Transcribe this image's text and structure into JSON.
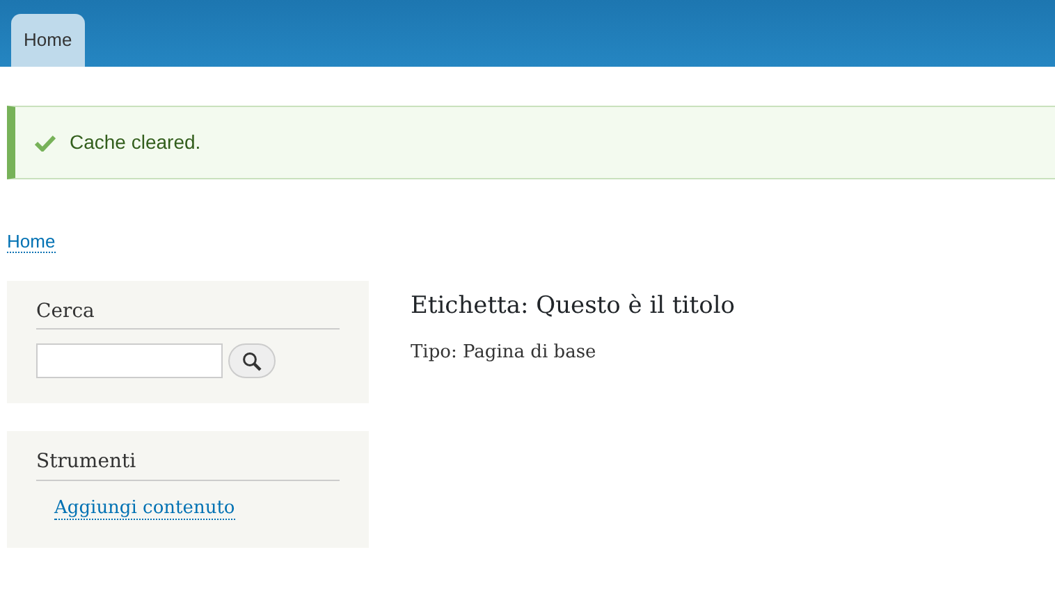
{
  "tabs": [
    {
      "label": "Home",
      "selected": true
    }
  ],
  "message": {
    "kind": "status",
    "text": "Cache cleared."
  },
  "breadcrumb": [
    {
      "label": "Home"
    }
  ],
  "sidebar": [
    {
      "kind": "search",
      "title": "Cerca"
    },
    {
      "kind": "links",
      "title": "Strumenti",
      "links": [
        {
          "label": "Aggiungi contenuto"
        }
      ]
    }
  ],
  "content": {
    "title": "Etichetta: Questo è il titolo",
    "meta": "Tipo: Pagina di base"
  }
}
